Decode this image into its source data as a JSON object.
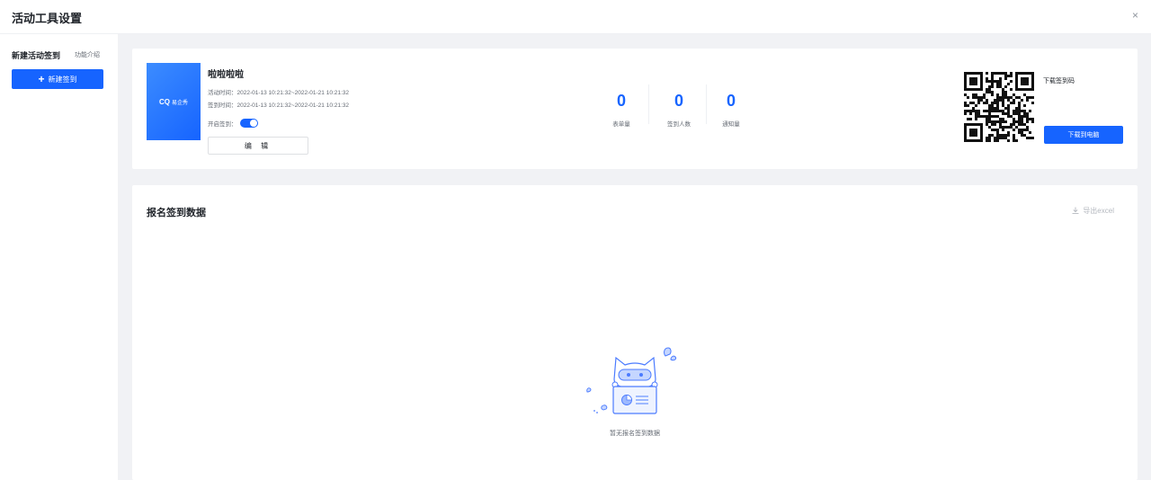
{
  "header": {
    "title": "活动工具设置",
    "close_label": "×"
  },
  "sidebar": {
    "title": "新建活动签到",
    "intro_link": "功能介绍",
    "new_button": {
      "icon": "plus-icon",
      "label": "新建签到"
    }
  },
  "activity": {
    "title": "啦啦啦啦",
    "cover_brand": "易企秀",
    "activity_time": "活动时间：2022-01-13 10:21:32~2022-01-21 10:21:32",
    "signin_time": "签到时间：2022-01-13 10:21:32~2022-01-21 10:21:32",
    "toggle_label": "开启签到：",
    "toggle_on": true,
    "edit_label": "编 辑"
  },
  "stats": [
    {
      "value": "0",
      "label": "表单量"
    },
    {
      "value": "0",
      "label": "签到人数"
    },
    {
      "value": "0",
      "label": "通知量"
    }
  ],
  "qr": {
    "label": "下载签到码",
    "download_label": "下载到电脑"
  },
  "data_section": {
    "title": "报名签到数据",
    "export_icon": "download-icon",
    "export_label": "导出excel",
    "empty_text": "暂无报名签到数据"
  },
  "colors": {
    "accent": "#1664ff",
    "page_bg": "#f1f2f5"
  }
}
